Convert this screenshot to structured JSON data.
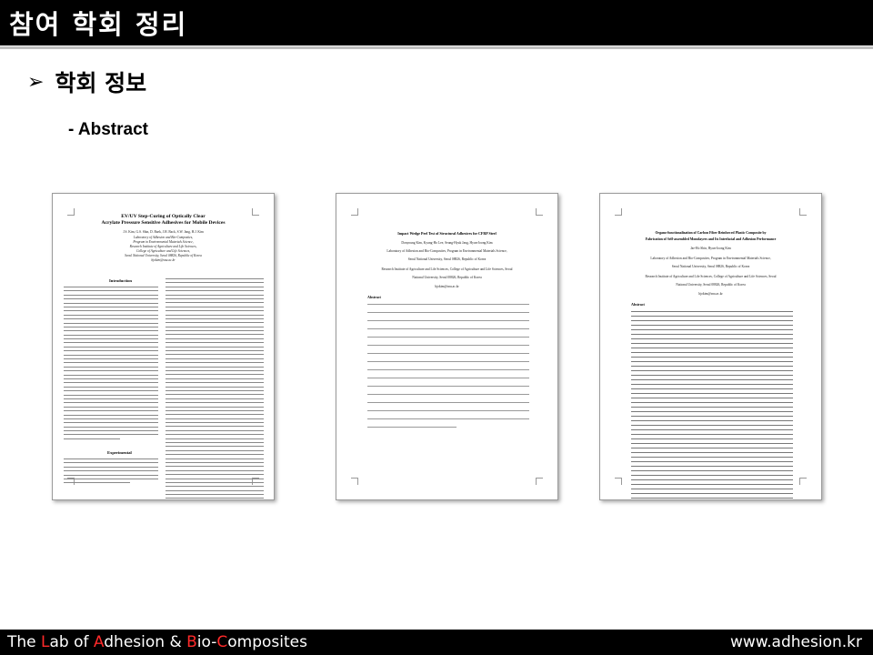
{
  "header": {
    "title": "참여 학회 정리"
  },
  "section": {
    "heading": "학회 정보",
    "bullet_icon": "arrow-right-icon",
    "subheading": "- Abstract"
  },
  "papers": [
    {
      "title_line1": "EV/UV Step-Curing of Optically Clear",
      "title_line2": "Acrylate Pressure Sensitive Adhesives for Mobile Devices",
      "authors": "J.S. Kim, G.S. Shin, D. Baek, J.H. Back, S.W. Jang, H.J. Kim",
      "affil1": "Laboratory of Adhesion and Bio-Composites,",
      "affil2": "Program in Environmental Materials Science,",
      "affil3": "Research Institute of Agriculture and Life Sciences,",
      "affil4": "College of Agriculture and Life Sciences,",
      "affil5": "Seoul National University, Seoul 08826, Republic of Korea",
      "email": "hjokim@snu.ac.kr",
      "section1": "Introduction",
      "section2": "Experimental"
    },
    {
      "title": "Impact Wedge Peel Test of Structural Adhesives for CFRP Steel",
      "authors": "Donyoung Kim, Kyung-Ho Lee, Seung-Hyuk Jang, Hyun-Joong Kim",
      "affil1": "Laboratory of Adhesion and Bio-Composites, Program in Environmental Materials Science,",
      "affil2": "Seoul National University, Seoul 08826, Republic of Korea",
      "affil3": "Research Institute of Agriculture and Life Sciences, College of Agriculture and Life Sciences, Seoul",
      "affil4": "National University, Seoul 08826, Republic of Korea",
      "email": "hjokim@snu.ac.kr",
      "section1": "Abstract"
    },
    {
      "title_line1": "Organo-functionalization of Carbon Fiber Reinforced Plastic Composite by",
      "title_line2": "Fabrication of Self-assembled Monolayers and Its Interfacial and Adhesion Performance",
      "authors": "Jae-Ho Shin, Hyun-Joong Kim",
      "affil1": "Laboratory of Adhesion and Bio-Composites, Program in Environmental Materials Science,",
      "affil2": "Seoul National University, Seoul 08826, Republic of Korea",
      "affil3": "Research Institute of Agriculture and Life Sciences, College of Agriculture and Life Sciences, Seoul",
      "affil4": "National University, Seoul 08826, Republic of Korea",
      "email": "hjokim@snu.ac.kr",
      "section1": "Abstract"
    }
  ],
  "footer": {
    "lab_the": "The ",
    "lab_l": "L",
    "lab_ab": "ab of ",
    "lab_a": "A",
    "lab_dhesion": "dhesion & ",
    "lab_b": "B",
    "lab_io": "io-",
    "lab_c": "C",
    "lab_omposites": "omposites",
    "website": "www.adhesion.kr"
  }
}
